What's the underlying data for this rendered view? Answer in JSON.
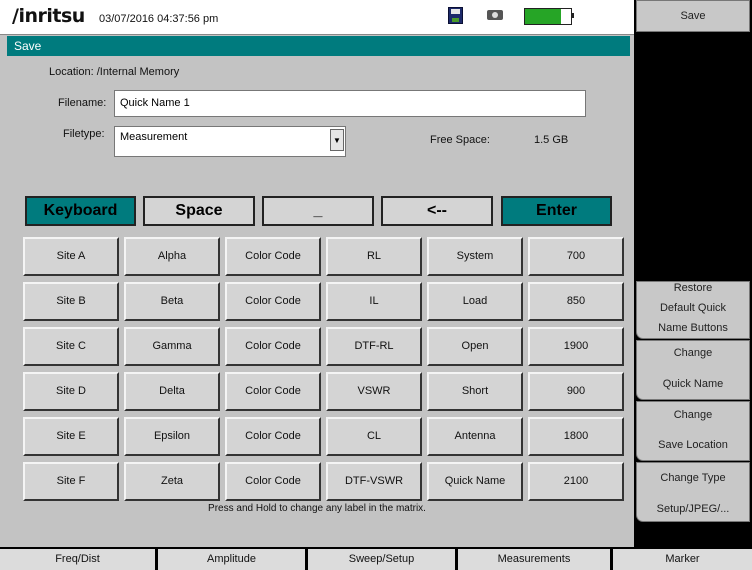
{
  "status_bar": {
    "brand": "/inritsu",
    "datetime": "03/07/2016 04:37:56 pm",
    "disk_icon": "disk-icon",
    "camera_icon": "camera-icon",
    "battery_level": 0.78,
    "battery_color": "#26a526"
  },
  "dialog": {
    "title": "Save",
    "location": "Location: /Internal Memory",
    "filename_label": "Filename:",
    "filename_value": "Quick Name 1",
    "filetype_label": "Filetype:",
    "filetype_value": "Measurement",
    "free_space_label": "Free Space:",
    "free_space_value": "1.5 GB"
  },
  "keyboard_row": {
    "keyboard": "Keyboard",
    "space": "Space",
    "underscore": "_",
    "backspace": "<--",
    "enter": "Enter"
  },
  "quick_names": [
    [
      "Site A",
      "Alpha",
      "Color Code",
      "RL",
      "System",
      "700"
    ],
    [
      "Site B",
      "Beta",
      "Color Code",
      "IL",
      "Load",
      "850"
    ],
    [
      "Site C",
      "Gamma",
      "Color Code",
      "DTF-RL",
      "Open",
      "1900"
    ],
    [
      "Site D",
      "Delta",
      "Color Code",
      "VSWR",
      "Short",
      "900"
    ],
    [
      "Site E",
      "Epsilon",
      "Color Code",
      "CL",
      "Antenna",
      "1800"
    ],
    [
      "Site F",
      "Zeta",
      "Color Code",
      "DTF-VSWR",
      "Quick Name",
      "2100"
    ]
  ],
  "hint": "Press and Hold to change any label in the matrix.",
  "softkeys": {
    "header": "Save",
    "restore": [
      "Restore",
      "Default Quick",
      "Name Buttons"
    ],
    "change_quick": [
      "Change",
      "Quick Name"
    ],
    "change_location": [
      "Change",
      "Save Location"
    ],
    "change_type": [
      "Change Type",
      "Setup/JPEG/..."
    ]
  },
  "tabs": [
    "Freq/Dist",
    "Amplitude",
    "Sweep/Setup",
    "Measurements",
    "Marker"
  ],
  "colors": {
    "accent": "#007b7e",
    "panel": "#c3c3c3"
  }
}
